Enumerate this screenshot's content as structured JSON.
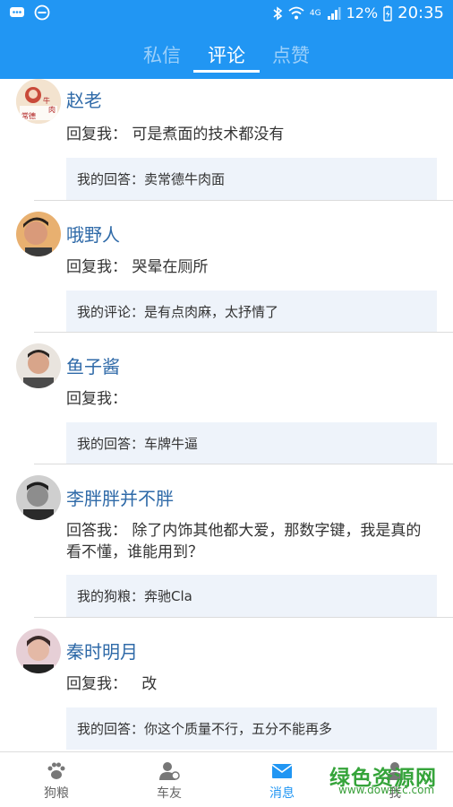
{
  "status_bar": {
    "battery": "12%",
    "time": "20:35",
    "network": "4G"
  },
  "tabs": [
    {
      "label": "私信",
      "active": false
    },
    {
      "label": "评论",
      "active": true
    },
    {
      "label": "点赞",
      "active": false
    }
  ],
  "comments": [
    {
      "name": "赵老",
      "reply": "回复我： 可是煮面的技术都没有",
      "answer": "我的回答：卖常德牛肉面",
      "avatar_text": "牛肉 常德"
    },
    {
      "name": "哦野人",
      "reply": "回复我： 哭晕在厕所",
      "answer": "我的评论：是有点肉麻，太抒情了"
    },
    {
      "name": "鱼子酱",
      "reply": "回复我：",
      "answer": "我的回答：车牌牛逼"
    },
    {
      "name": "李胖胖并不胖",
      "reply": "回答我： 除了内饰其他都大爱，那数字键，我是真的看不懂，谁能用到？",
      "answer": "我的狗粮：奔驰Cla"
    },
    {
      "name": "秦时明月",
      "reply": "回复我：   改",
      "answer": "我的回答：你这个质量不行，五分不能再多"
    }
  ],
  "bottom_nav": [
    {
      "label": "狗粮",
      "icon": "paw-icon",
      "active": false
    },
    {
      "label": "车友",
      "icon": "person-icon",
      "active": false
    },
    {
      "label": "消息",
      "icon": "mail-icon",
      "active": true
    },
    {
      "label": "我",
      "icon": "profile-icon",
      "active": false
    }
  ],
  "watermark": {
    "title": "绿色资源网",
    "url": "www.downcc.com"
  },
  "colors": {
    "primary": "#2196f3",
    "name": "#2f6aa8",
    "answer_bg": "#eef3fa",
    "watermark": "#35a43a"
  }
}
